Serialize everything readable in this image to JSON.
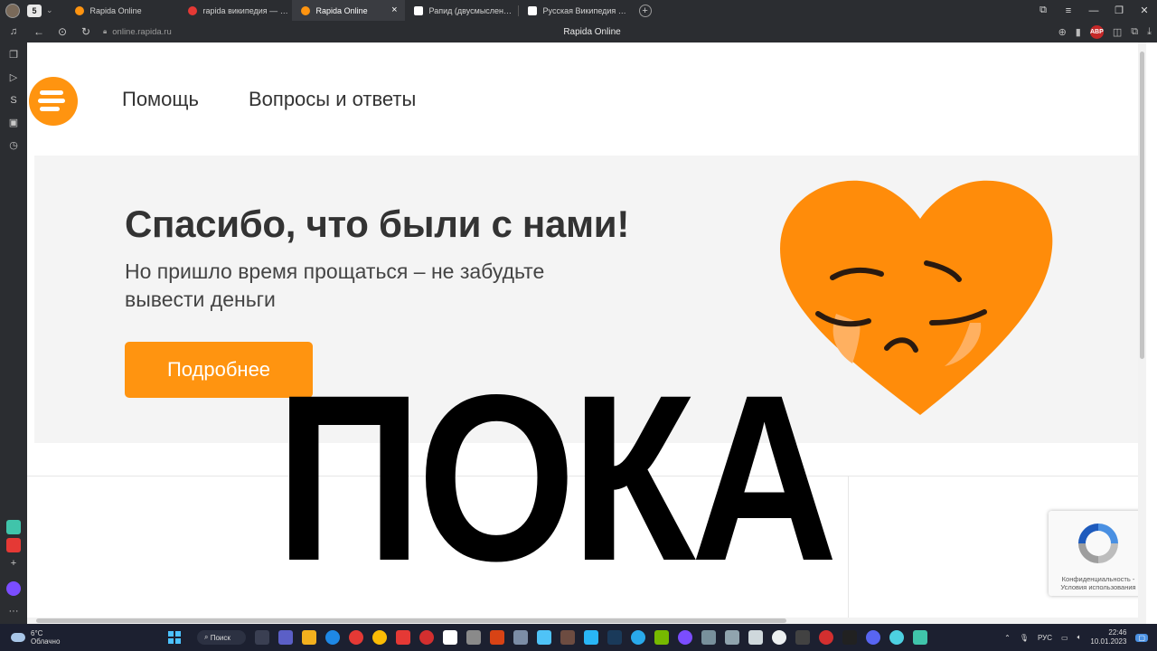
{
  "browser": {
    "tab_count": "5",
    "tabs": [
      {
        "label": "Rapida Online",
        "favicon_color": "#ff9410",
        "active": false
      },
      {
        "label": "rapida википедия — Яндекс",
        "favicon_color": "#e53935",
        "active": false
      },
      {
        "label": "Rapida Online",
        "favicon_color": "#ff9410",
        "active": true
      },
      {
        "label": "Рапид (двусмысленность)",
        "favicon_color": "#ffffff",
        "active": false
      },
      {
        "label": "Русская Википедия - Вики",
        "favicon_color": "#ffffff",
        "active": false
      }
    ],
    "close_glyph": "×",
    "new_tab_glyph": "+",
    "url": "online.rapida.ru",
    "page_title": "Rapida Online",
    "adblock_label": "ABP"
  },
  "header": {
    "nav": [
      "Помощь",
      "Вопросы и ответы"
    ]
  },
  "banner": {
    "headline": "Спасибо, что были с нами!",
    "subtext": "Но пришло время прощаться – не забудьте вывести деньги",
    "button_label": "Подробнее"
  },
  "overlay": {
    "caption": "ПОКА"
  },
  "recaptcha": {
    "text": "Конфиденциальность - Условия использования"
  },
  "taskbar": {
    "temperature": "6°C",
    "weather": "Облачно",
    "search_label": "Поиск",
    "language": "РУС",
    "time": "22:46",
    "date": "10.01.2023"
  },
  "colors": {
    "brand_orange": "#ff9410",
    "banner_bg": "#f4f4f4",
    "browser_chrome": "#2b2d31"
  }
}
